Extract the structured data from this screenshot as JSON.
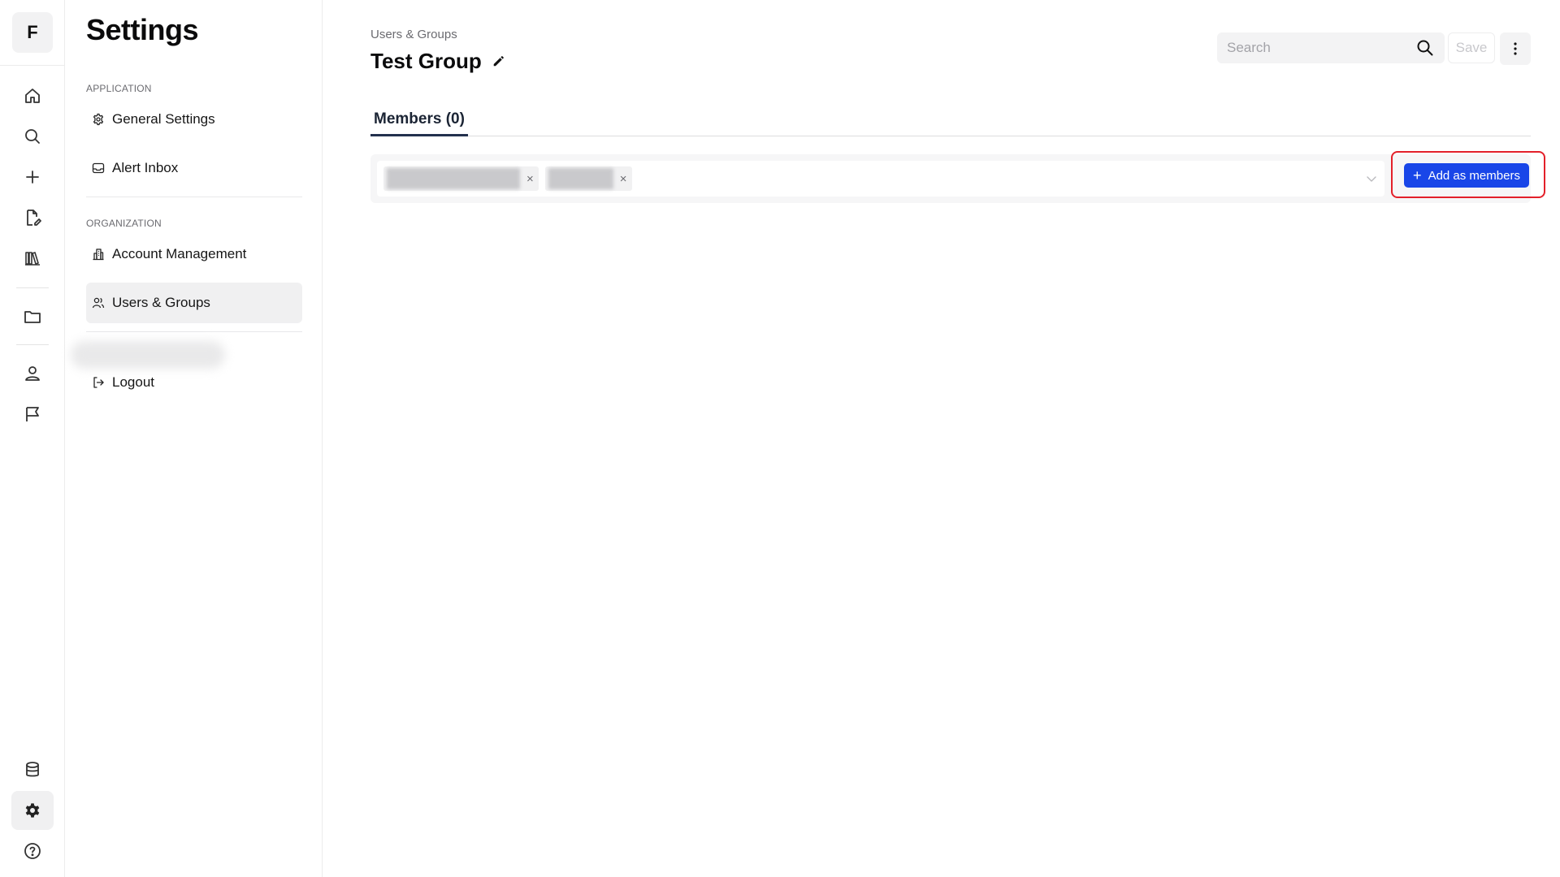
{
  "rail": {
    "logo_letter": "F",
    "icons": [
      "home-icon",
      "search-icon",
      "plus-icon",
      "edit-document-icon",
      "library-icon",
      "folder-icon",
      "user-icon",
      "flag-icon",
      "database-icon",
      "gear-icon",
      "help-icon"
    ],
    "active": "gear-icon"
  },
  "menu": {
    "title": "Settings",
    "section_application": "APPLICATION",
    "section_organization": "ORGANIZATION",
    "general_settings": "General Settings",
    "alert_inbox": "Alert Inbox",
    "account_management": "Account Management",
    "users_groups": "Users & Groups",
    "logout": "Logout",
    "active": "Users & Groups"
  },
  "header": {
    "breadcrumb": "Users & Groups",
    "title": "Test Group",
    "search_placeholder": "Search",
    "save_label": "Save"
  },
  "tabs": {
    "members": "Members (0)"
  },
  "members": {
    "add_button_label": "Add as members",
    "remove_symbol": "×"
  },
  "colors": {
    "accent": "#1946e8",
    "highlight": "#e3202a",
    "tab_underline": "#23314d"
  }
}
